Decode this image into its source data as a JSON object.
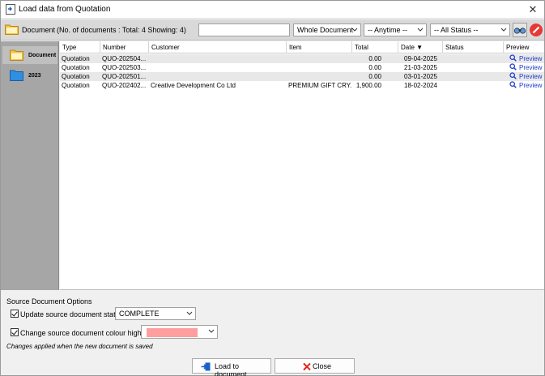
{
  "window": {
    "title": "Load data from Quotation"
  },
  "toolbar": {
    "doc_label": "Document",
    "doc_count": "(No. of documents : Total:  4   Showing:  4)",
    "search_value": "",
    "scope_select": "Whole Document",
    "date_select": "-- Anytime --",
    "status_select": "-- All Status --"
  },
  "sidebar": {
    "items": [
      {
        "label": "Document",
        "icon": "folder-open-icon",
        "selected": true
      },
      {
        "label": "2023",
        "icon": "folder-icon",
        "selected": false
      }
    ]
  },
  "grid": {
    "columns": [
      "Type",
      "Number",
      "Customer",
      "Item",
      "Total",
      "Date ▼",
      "Status",
      "Preview"
    ],
    "rows": [
      {
        "type": "Quotation",
        "number": "QUO-202504...",
        "customer": "",
        "item": "",
        "total": "0.00",
        "date": "09-04-2025",
        "status": "",
        "preview": "Preview"
      },
      {
        "type": "Quotation",
        "number": "QUO-202503...",
        "customer": "",
        "item": "",
        "total": "0.00",
        "date": "21-03-2025",
        "status": "",
        "preview": "Preview"
      },
      {
        "type": "Quotation",
        "number": "QUO-202501...",
        "customer": "",
        "item": "",
        "total": "0.00",
        "date": "03-01-2025",
        "status": "",
        "preview": "Preview"
      },
      {
        "type": "Quotation",
        "number": "QUO-202402...",
        "customer": "Creative Development Co Ltd",
        "item": "PREMIUM GIFT CRY...",
        "total": "1,900.00",
        "date": "18-02-2024",
        "status": "",
        "preview": "Preview"
      }
    ]
  },
  "options": {
    "title": "Source Document Options",
    "update_status_label": "Update source document status",
    "update_status_checked": true,
    "update_status_value": "COMPLETE",
    "colour_label": "Change source document colour highlight",
    "colour_checked": true,
    "colour_value": "#ff9e9e",
    "note": "Changes applied when the new document is saved"
  },
  "buttons": {
    "load": "Load to document",
    "close": "Close"
  },
  "colors": {
    "toolbar_bg": "#d9d9d9",
    "sidebar_bg": "#a6a6a6",
    "link": "#1a3ccc",
    "row_alt": "#e8e8e8"
  }
}
